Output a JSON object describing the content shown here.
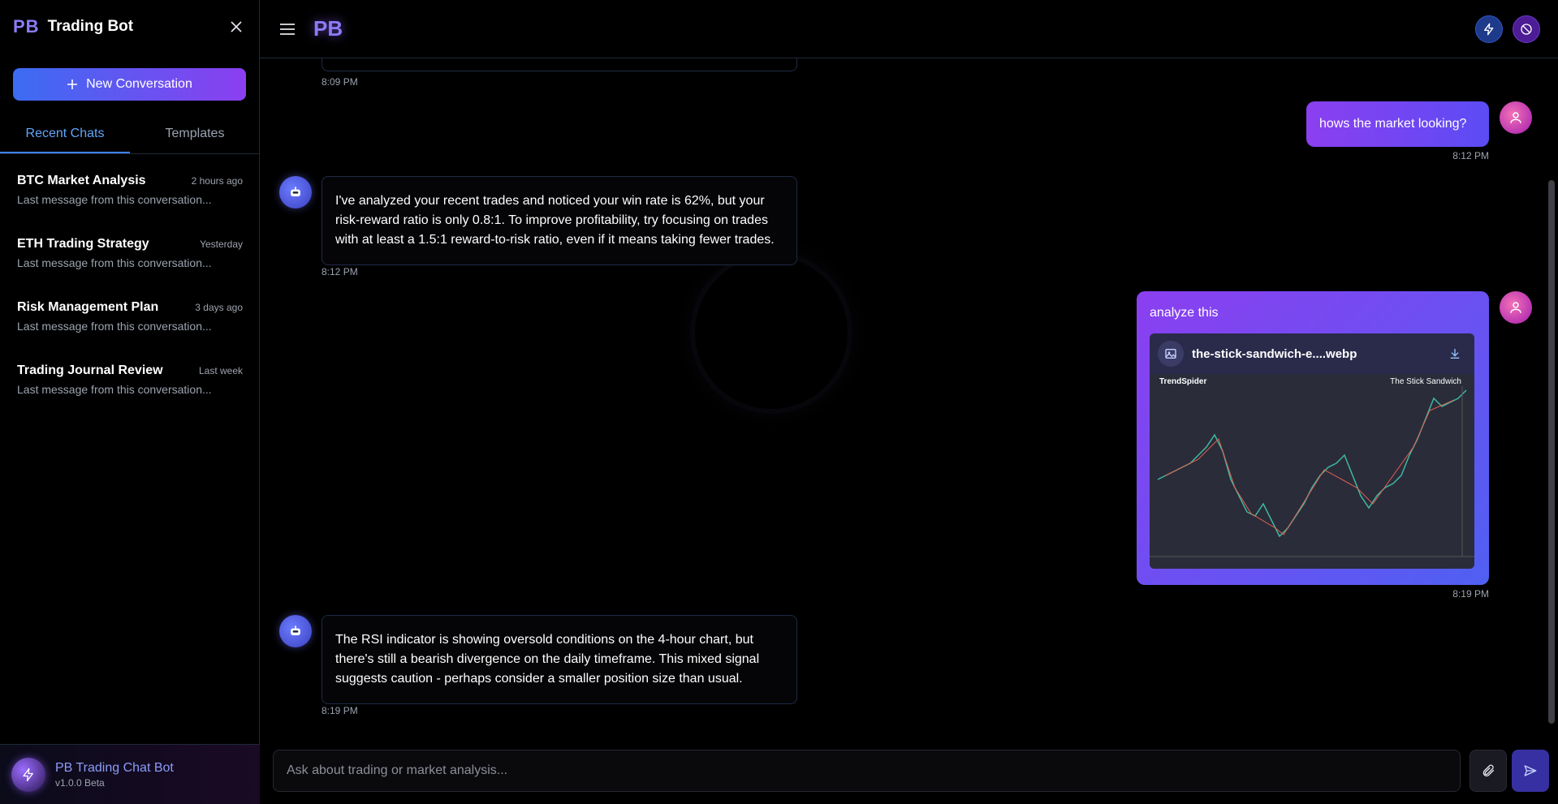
{
  "sidebar": {
    "logo": "PB",
    "title": "Trading Bot",
    "new_conversation_label": "New Conversation",
    "tabs": [
      {
        "label": "Recent Chats",
        "active": true
      },
      {
        "label": "Templates",
        "active": false
      }
    ],
    "chats": [
      {
        "name": "BTC Market Analysis",
        "time": "2 hours ago",
        "preview": "Last message from this conversation..."
      },
      {
        "name": "ETH Trading Strategy",
        "time": "Yesterday",
        "preview": "Last message from this conversation..."
      },
      {
        "name": "Risk Management Plan",
        "time": "3 days ago",
        "preview": "Last message from this conversation..."
      },
      {
        "name": "Trading Journal Review",
        "time": "Last week",
        "preview": "Last message from this conversation..."
      }
    ],
    "footer": {
      "name": "PB Trading Chat Bot",
      "version": "v1.0.0 Beta"
    }
  },
  "topbar": {
    "logo": "PB"
  },
  "messages": {
    "m0_time": "8:09 PM",
    "m1_text": "hows the market looking?",
    "m1_time": "8:12 PM",
    "m2_text": "I've analyzed your recent trades and noticed your win rate is 62%, but your risk-reward ratio is only 0.8:1. To improve profitability, try focusing on trades with at least a 1.5:1 reward-to-risk ratio, even if it means taking fewer trades.",
    "m2_time": "8:12 PM",
    "m3_text": "analyze this",
    "m3_attachment": "the-stick-sandwich-e....webp",
    "m3_img_brand": "TrendSpider",
    "m3_img_title": "The Stick Sandwich",
    "m3_time": "8:19 PM",
    "m4_text": "The RSI indicator is showing oversold conditions on the 4-hour chart, but there's still a bearish divergence on the daily timeframe. This mixed signal suggests caution - perhaps consider a smaller position size than usual.",
    "m4_time": "8:19 PM"
  },
  "input": {
    "placeholder": "Ask about trading or market analysis..."
  },
  "colors": {
    "accent": "#8b7cf6",
    "gradient_start": "#3b6cf2",
    "gradient_end": "#8b3ff0"
  }
}
